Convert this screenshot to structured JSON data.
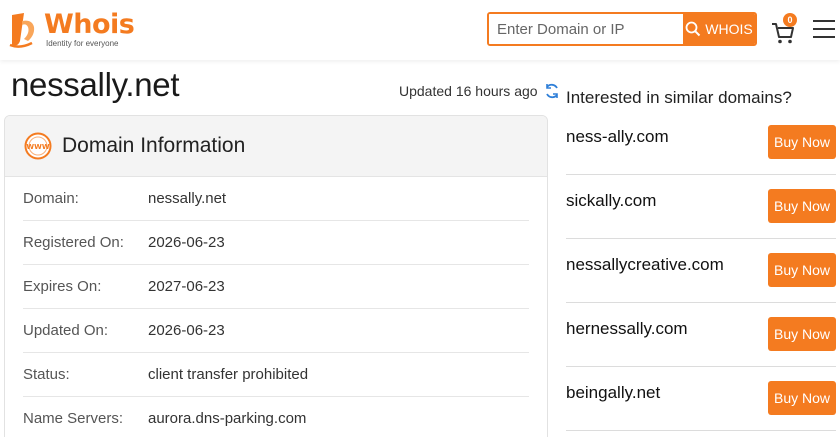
{
  "header": {
    "logo_text": "Whois",
    "logo_tagline": "Identity for everyone",
    "search_placeholder": "Enter Domain or IP",
    "search_button_label": "WHOIS",
    "cart_count": "0",
    "brand_color": "#f47b20"
  },
  "domain_title": "nessally.net",
  "updated_text": "Updated 16 hours ago",
  "domain_info": {
    "title": "Domain Information",
    "rows": [
      {
        "label": "Domain:",
        "value": "nessally.net"
      },
      {
        "label": "Registered On:",
        "value": "2026-06-23"
      },
      {
        "label": "Expires On:",
        "value": "2027-06-23"
      },
      {
        "label": "Updated On:",
        "value": "2026-06-23"
      },
      {
        "label": "Status:",
        "value": "client transfer prohibited"
      },
      {
        "label": "Name Servers:",
        "value": "aurora.dns-parking.com"
      }
    ]
  },
  "similar": {
    "title": "Interested in similar domains?",
    "buy_label": "Buy Now",
    "items": [
      {
        "name": "ness-ally.com"
      },
      {
        "name": "sickally.com"
      },
      {
        "name": "nessallycreative.com"
      },
      {
        "name": "hernessally.com"
      },
      {
        "name": "beingally.net"
      }
    ]
  }
}
